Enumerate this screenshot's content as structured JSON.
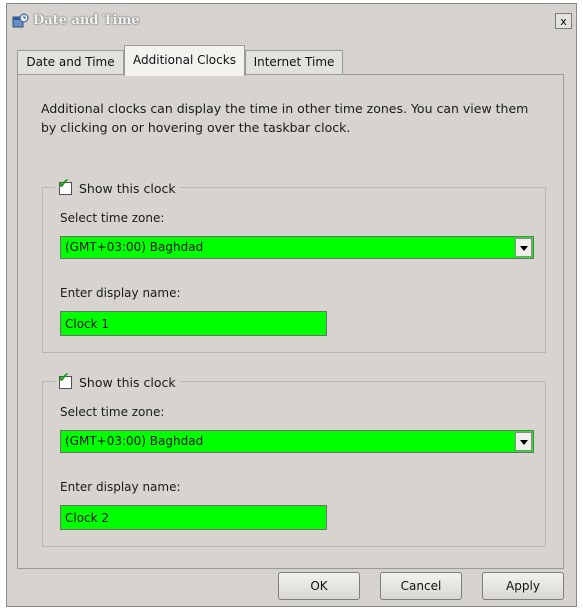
{
  "window": {
    "title": "Date and Time",
    "close_label": "x"
  },
  "tabs": [
    {
      "label": "Date and Time",
      "active": false
    },
    {
      "label": "Additional Clocks",
      "active": true
    },
    {
      "label": "Internet Time",
      "active": false
    }
  ],
  "description": "Additional clocks can display the time in other time zones. You can view them by clicking on or hovering over the taskbar clock.",
  "clocks": [
    {
      "show_label": "Show this clock",
      "checked": true,
      "timezone_label": "Select time zone:",
      "timezone_value": "(GMT+03:00) Baghdad",
      "name_label": "Enter display name:",
      "name_value": "Clock 1"
    },
    {
      "show_label": "Show this clock",
      "checked": true,
      "timezone_label": "Select time zone:",
      "timezone_value": "(GMT+03:00) Baghdad",
      "name_label": "Enter display name:",
      "name_value": "Clock 2"
    }
  ],
  "buttons": {
    "ok": "OK",
    "cancel": "Cancel",
    "apply": "Apply"
  },
  "colors": {
    "highlight_field": "#00ff00",
    "dialog_bg": "#d6d3ce"
  },
  "icons": {
    "app": "date-time-icon",
    "check": "check-icon",
    "dropdown": "chevron-down-icon"
  }
}
